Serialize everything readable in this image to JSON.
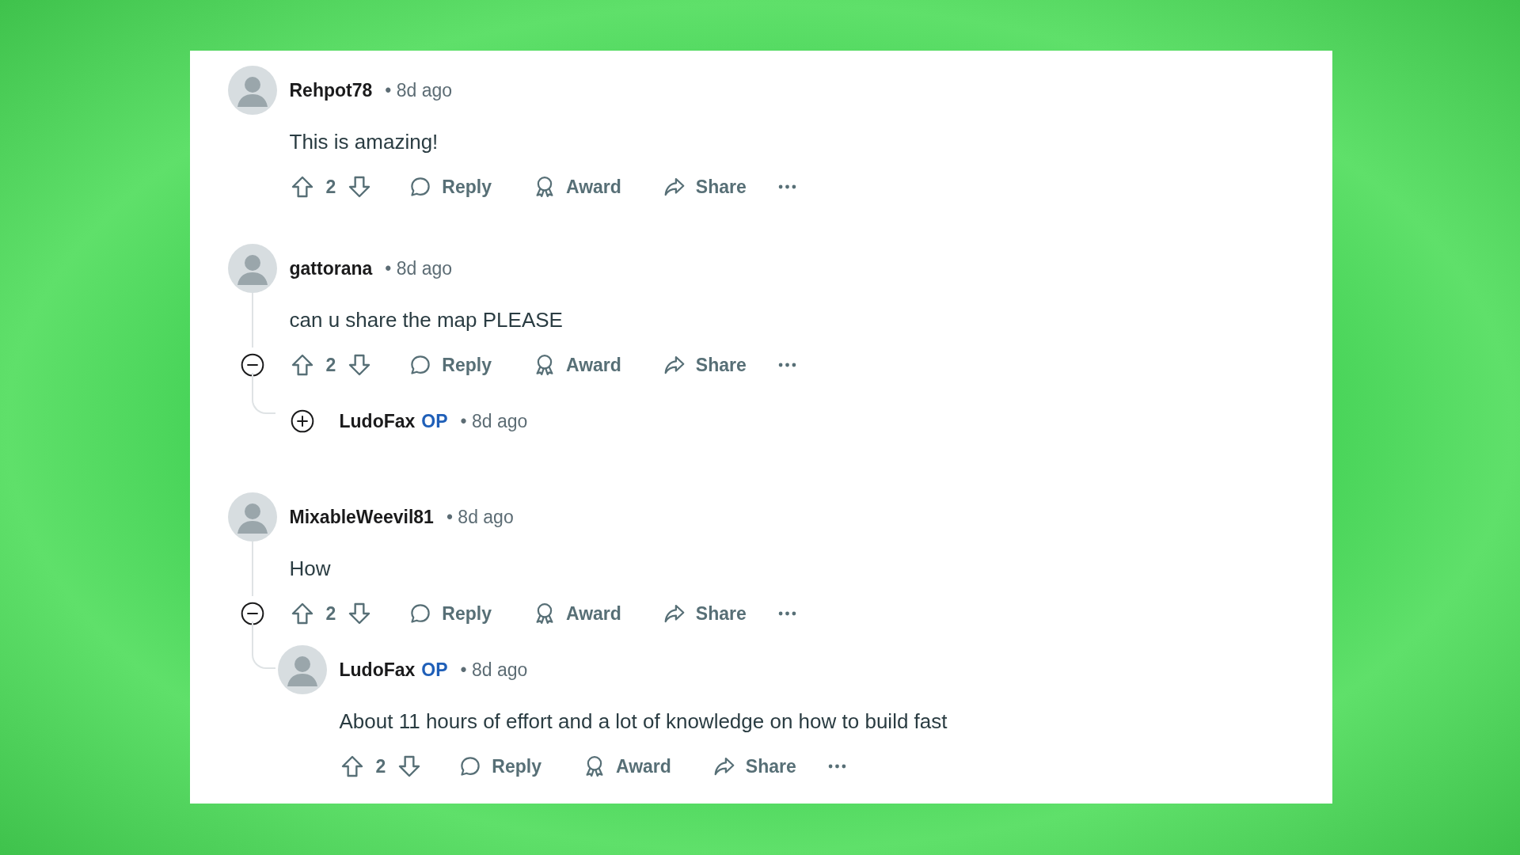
{
  "comments": [
    {
      "author": "Rehpot78",
      "time": "• 8d ago",
      "body": "This is amazing!",
      "score": "2",
      "actions": [
        "Reply",
        "Award",
        "Share"
      ]
    },
    {
      "author": "gattorana",
      "time": "• 8d ago",
      "body": "can u share the map PLEASE",
      "score": "2",
      "expanded": true,
      "actions": [
        "Reply",
        "Award",
        "Share"
      ],
      "replies": [
        {
          "author": "LudoFax",
          "op_label": "OP",
          "time": "• 8d ago",
          "expanded": false
        }
      ]
    },
    {
      "author": "MixableWeevil81",
      "time": "• 8d ago",
      "body": "How",
      "score": "2",
      "expanded": true,
      "actions": [
        "Reply",
        "Award",
        "Share"
      ],
      "replies": [
        {
          "author": "LudoFax",
          "op_label": "OP",
          "time": "• 8d ago",
          "body": "About 11 hours of effort and a lot of knowledge on how to build fast",
          "score": "2",
          "actions": [
            "Reply",
            "Award",
            "Share"
          ]
        }
      ]
    }
  ]
}
